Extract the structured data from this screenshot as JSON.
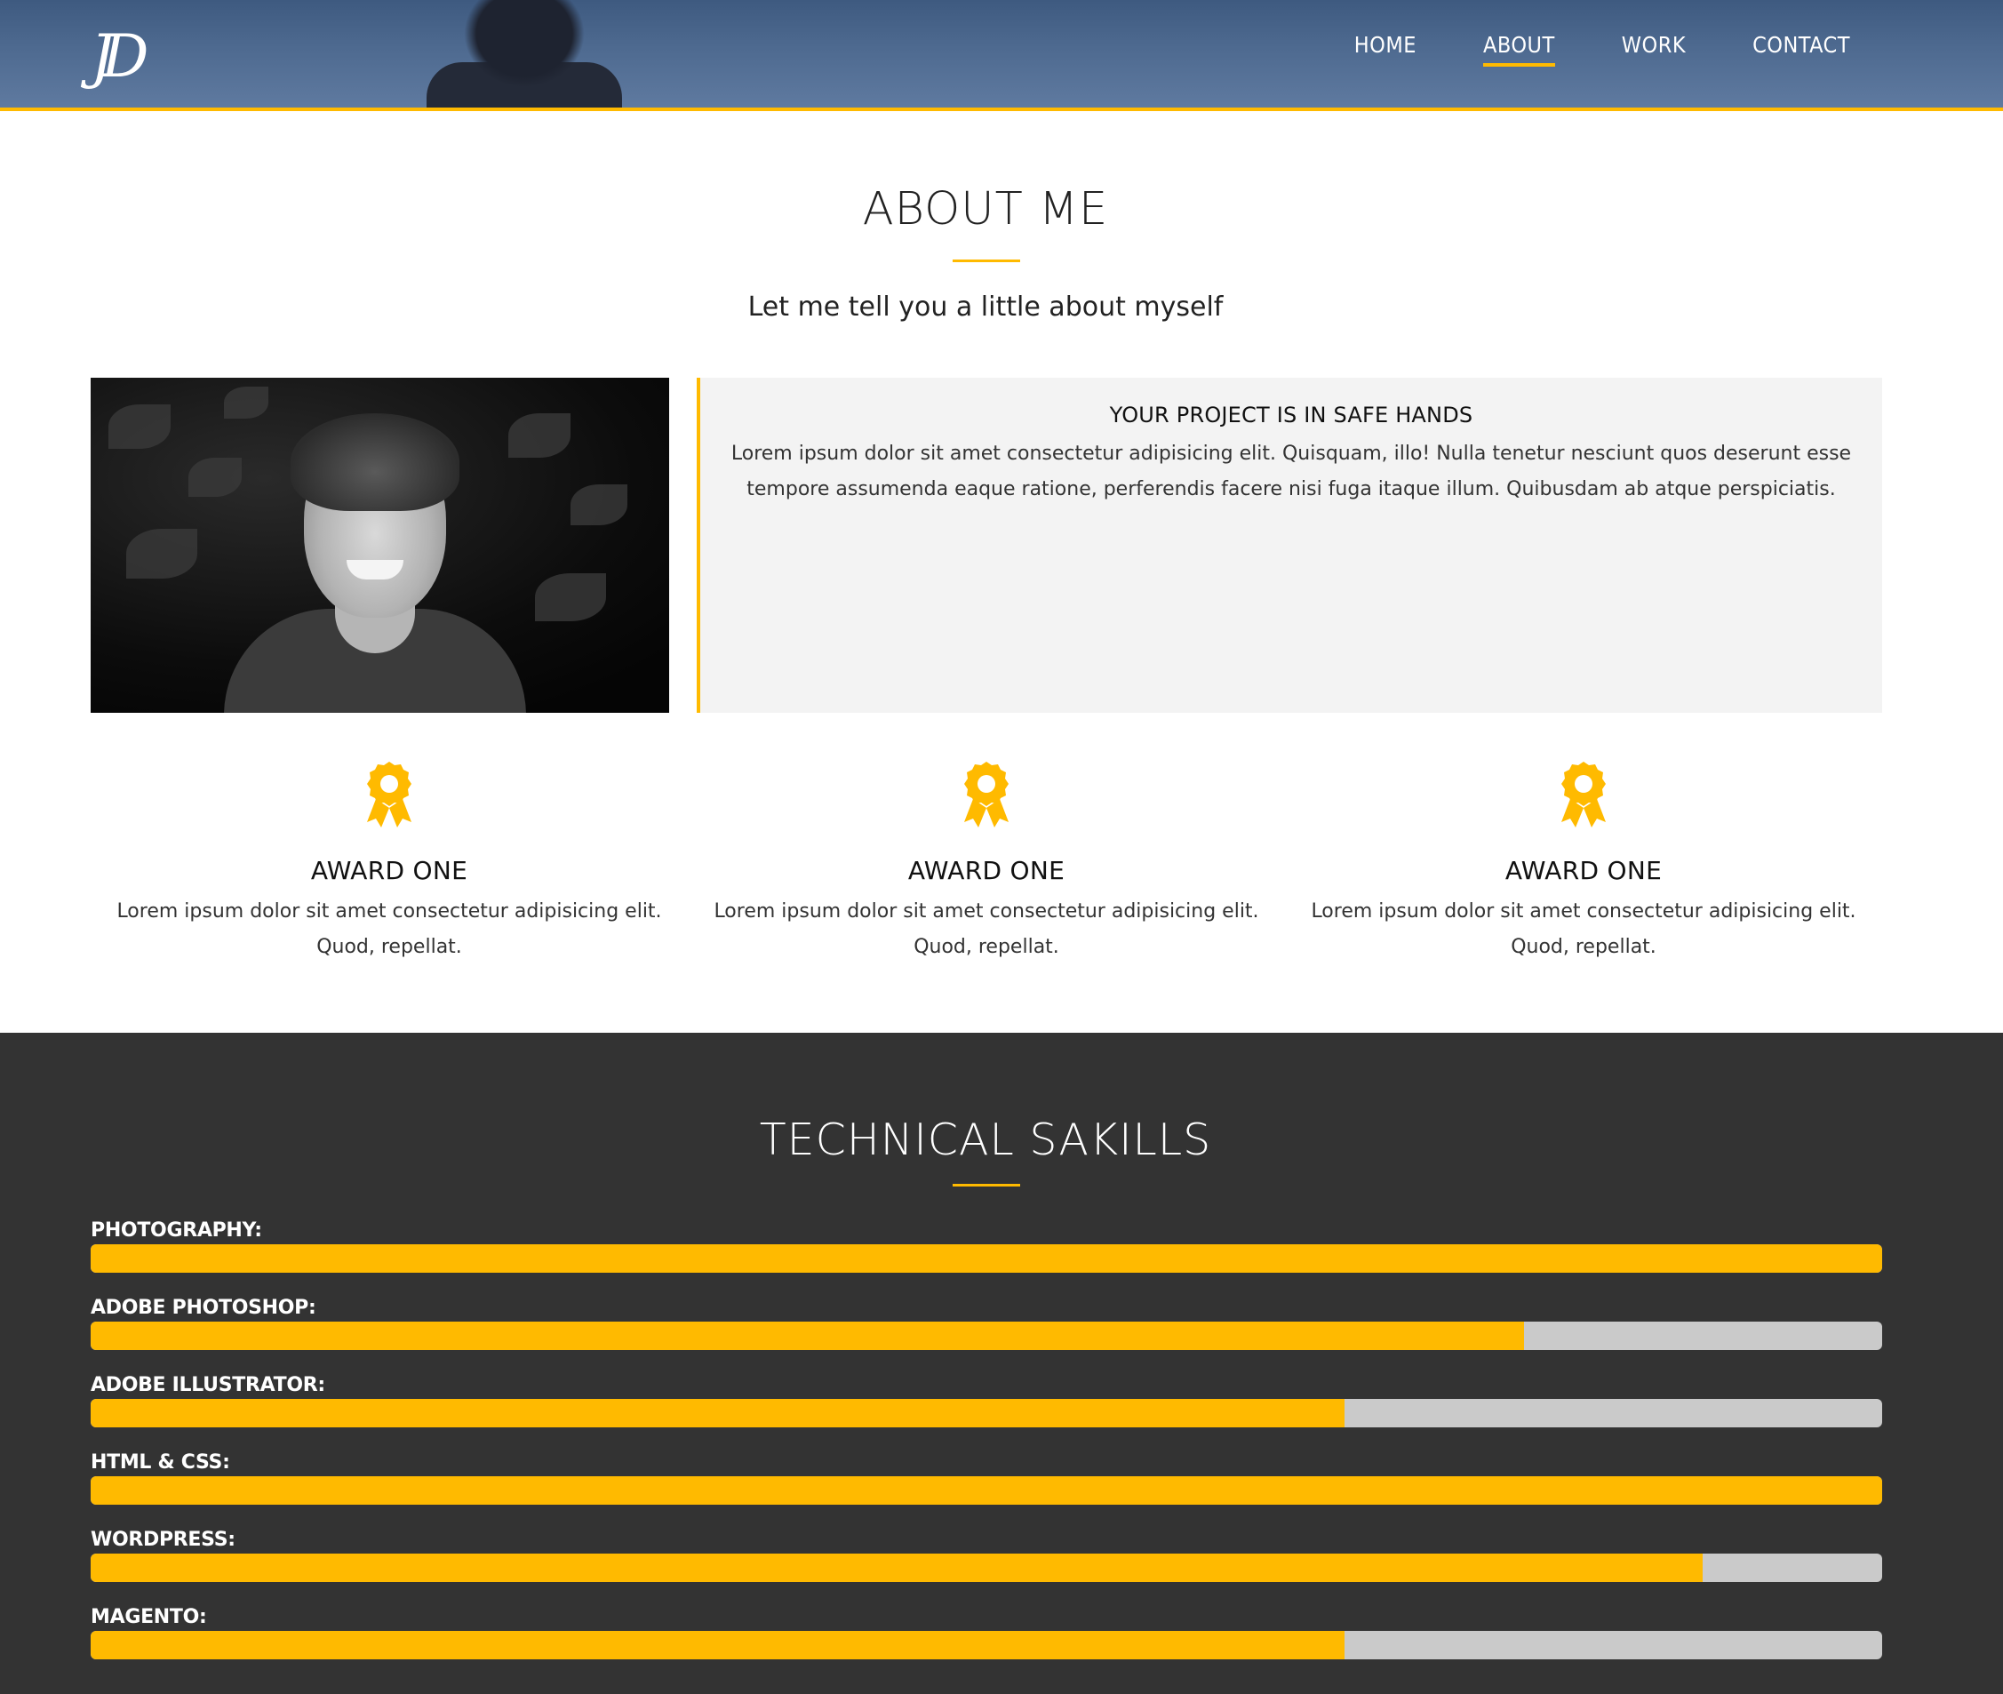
{
  "header": {
    "logo": "JD",
    "nav": [
      {
        "label": "HOME",
        "active": false
      },
      {
        "label": "ABOUT",
        "active": true
      },
      {
        "label": "WORK",
        "active": false
      },
      {
        "label": "CONTACT",
        "active": false
      }
    ]
  },
  "about": {
    "title": "ABOUT ME",
    "subtitle": "Let me tell you a little about myself",
    "box_title": "YOUR PROJECT IS IN SAFE HANDS",
    "box_text": "Lorem ipsum dolor sit amet consectetur adipisicing elit. Quisquam, illo! Nulla tenetur nesciunt quos deserunt esse tempore assumenda eaque ratione, perferendis facere nisi fuga itaque illum. Quibusdam ab atque perspiciatis."
  },
  "awards": [
    {
      "icon": "award-ribbon-icon",
      "title": "AWARD ONE",
      "text": "Lorem ipsum dolor sit amet consectetur adipisicing elit. Quod, repellat."
    },
    {
      "icon": "award-ribbon-icon",
      "title": "AWARD ONE",
      "text": "Lorem ipsum dolor sit amet consectetur adipisicing elit. Quod, repellat."
    },
    {
      "icon": "award-ribbon-icon",
      "title": "AWARD ONE",
      "text": "Lorem ipsum dolor sit amet consectetur adipisicing elit. Quod, repellat."
    }
  ],
  "skills": {
    "title": "TECHNICAL SAKILLS",
    "items": [
      {
        "label": "PHOTOGRAPHY:",
        "level": 1.0
      },
      {
        "label": "ADOBE PHOTOSHOP:",
        "level": 0.8
      },
      {
        "label": "ADOBE ILLUSTRATOR:",
        "level": 0.7
      },
      {
        "label": "HTML & CSS:",
        "level": 1.0
      },
      {
        "label": "WORDPRESS:",
        "level": 0.9
      },
      {
        "label": "MAGENTO:",
        "level": 0.7
      }
    ]
  },
  "colors": {
    "accent": "#ffba00",
    "dark_section": "#333333",
    "box_bg": "#f3f3f3",
    "track": "#cacaca"
  }
}
